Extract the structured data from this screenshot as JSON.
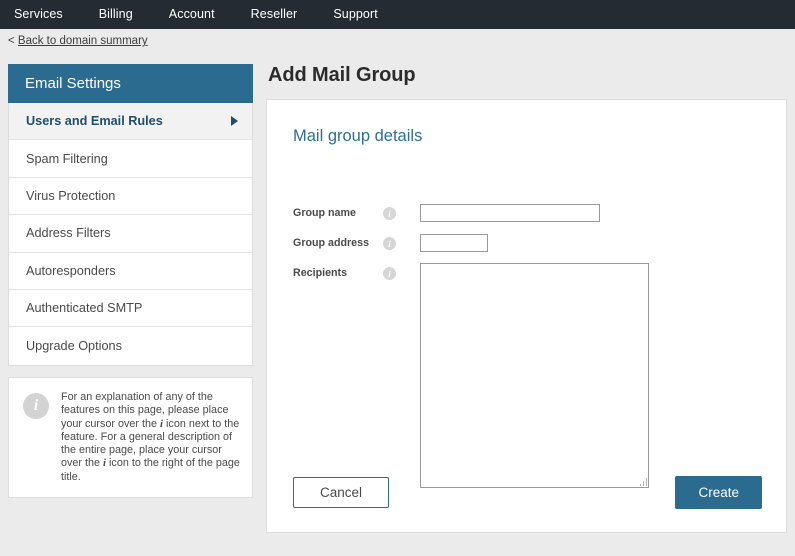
{
  "topnav": {
    "items": [
      {
        "label": "Services"
      },
      {
        "label": "Billing"
      },
      {
        "label": "Account"
      },
      {
        "label": "Reseller"
      },
      {
        "label": "Support"
      }
    ]
  },
  "breadcrumb": {
    "prefix": "< ",
    "link_label": "Back to domain summary"
  },
  "sidebar": {
    "header": "Email Settings",
    "items": [
      {
        "label": "Users and Email Rules",
        "active": true,
        "caret": "caret-right-icon"
      },
      {
        "label": "Spam Filtering",
        "active": false
      },
      {
        "label": "Virus Protection",
        "active": false
      },
      {
        "label": "Address Filters",
        "active": false
      },
      {
        "label": "Autoresponders",
        "active": false
      },
      {
        "label": "Authenticated SMTP",
        "active": false
      },
      {
        "label": "Upgrade Options",
        "active": false
      }
    ],
    "info_box": {
      "icon": "info-icon",
      "icon_glyph": "i",
      "text_part_1": "For an explanation of any of the features on this page, please place your cursor over the ",
      "emphasis_1": "i",
      "text_part_2": " icon next to the feature. For a general description of the entire page, place your cursor over the ",
      "emphasis_2": "i",
      "text_part_3": " icon to the right of the page title."
    }
  },
  "main": {
    "page_title": "Add Mail Group",
    "card_title": "Mail group details",
    "fields": [
      {
        "label": "Group name",
        "info_icon": "info-icon",
        "info_glyph": "i",
        "type": "text",
        "value": "",
        "placeholder": ""
      },
      {
        "label": "Group address",
        "info_icon": "info-icon",
        "info_glyph": "i",
        "type": "text",
        "value": "",
        "placeholder": ""
      },
      {
        "label": "Recipients",
        "info_icon": "info-icon",
        "info_glyph": "i",
        "type": "textarea",
        "value": "",
        "placeholder": ""
      }
    ],
    "buttons": {
      "cancel_label": "Cancel",
      "create_label": "Create"
    }
  },
  "colors": {
    "topnav_bg": "#242b33",
    "page_bg": "#ebebeb",
    "accent_blue": "#2a6b8f",
    "card_title_blue": "#2e6f92",
    "active_item_text": "#1f4e68",
    "card_bg": "#ffffff",
    "border_gray": "#dcdcdc",
    "input_border": "#9a9a9a",
    "info_circle_gray": "#d3d3d3"
  }
}
